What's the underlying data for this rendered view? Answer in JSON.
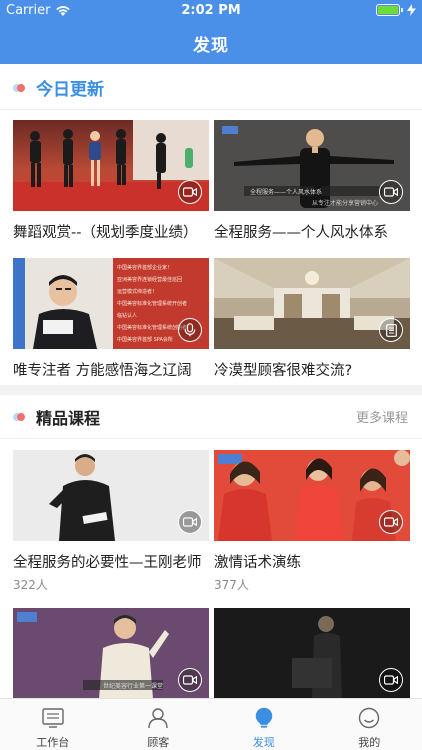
{
  "status_bar": {
    "carrier": "Carrier",
    "time": "2:02 PM",
    "battery_level": 1.0
  },
  "nav": {
    "title": "发现"
  },
  "today": {
    "title": "今日更新",
    "items": [
      {
        "title": "舞蹈观赏--（规划季度业绩）",
        "media": "video-icon"
      },
      {
        "title": "全程服务——个人风水体系",
        "media": "video-icon"
      },
      {
        "title": "唯专注者 方能感悟海之辽阔",
        "media": "microphone-icon"
      },
      {
        "title": "冷漠型顾客很难交流?",
        "media": "document-icon"
      }
    ],
    "banner_text": [
      "中国美容界首部企业家！",
      "亚洲美容界连锁经营最佳巡回",
      "运营模式缔造者！",
      "中国美容标准化管理系统开创者",
      "临钻认人",
      "中国美容标准化管理系统创始者",
      "中国美容界首部 SPA会所"
    ],
    "video_overlay": "全程服务——个人风水体系",
    "video_subtitle": "从专注才能分享营销中心"
  },
  "courses": {
    "title": "精品课程",
    "more_label": "更多课程",
    "items": [
      {
        "title": "全程服务的必要性—王刚老师",
        "count": "322人",
        "media": "video-icon"
      },
      {
        "title": "激情话术演练",
        "count": "377人",
        "media": "video-icon"
      },
      {
        "title": "",
        "count": "",
        "media": "video-icon"
      },
      {
        "title": "",
        "count": "",
        "media": "video-icon"
      }
    ],
    "thumb_subtitle": "世纪美容行业第一课堂"
  },
  "tabbar": {
    "items": [
      {
        "label": "工作台",
        "icon": "workbench-icon",
        "active": false
      },
      {
        "label": "顾客",
        "icon": "customer-icon",
        "active": false
      },
      {
        "label": "发现",
        "icon": "discover-icon",
        "active": true
      },
      {
        "label": "我的",
        "icon": "profile-icon",
        "active": false
      }
    ]
  },
  "colors": {
    "accent": "#4a90e8",
    "active_tab": "#3b8fe0",
    "dot_red": "#f07070",
    "dot_blue": "#b7dbf7"
  }
}
